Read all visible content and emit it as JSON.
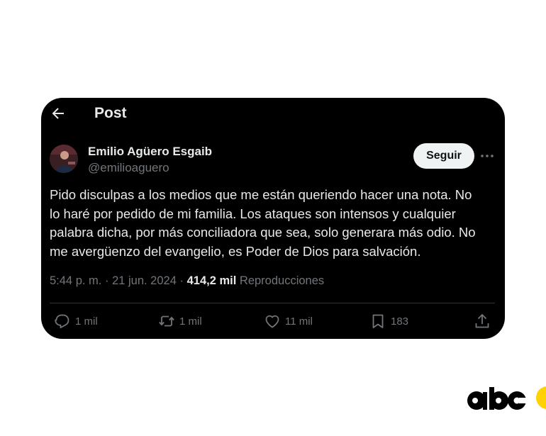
{
  "header": {
    "title": "Post",
    "back_icon": "arrow-left-icon"
  },
  "author": {
    "name": "Emilio Agüero Esgaib",
    "handle": "@emilioaguero",
    "follow_label": "Seguir",
    "more_icon": "more-horizontal-icon"
  },
  "post": {
    "text": "Pido disculpas a los medios que me están queriendo hacer una nota. No\nlo haré por pedido de mi familia. Los ataques son intensos y cualquier\npalabra dicha, por más conciliadora que sea, solo generara más odio. No\nme avergüenzo del evangelio, es Poder de Dios para salvación.",
    "time": "5:44 p. m.",
    "date": "21 jun. 2024",
    "views": "414,2 mil",
    "views_label": "Reproducciones"
  },
  "actions": {
    "replies": "1 mil",
    "reposts": "1 mil",
    "likes": "11 mil",
    "bookmarks": "183"
  },
  "colors": {
    "background": "#000000",
    "text": "#e7e9ea",
    "muted": "#71767b",
    "follow_button": "#eff3f4",
    "brand_yellow": "#ffd200"
  }
}
